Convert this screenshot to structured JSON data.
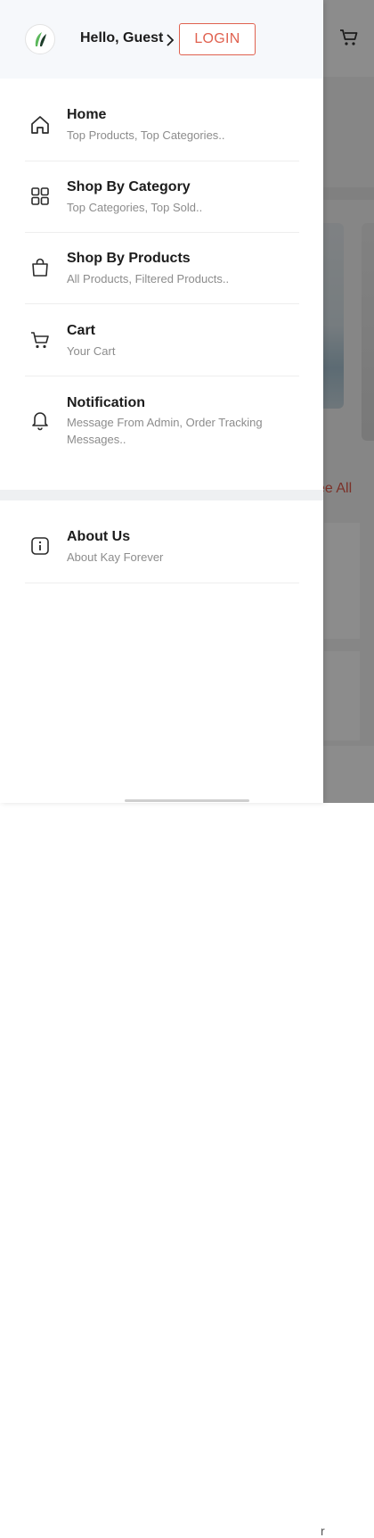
{
  "background": {
    "see_all_label": "ee All",
    "bottom_text": "r",
    "icons": [
      "cart-icon"
    ]
  },
  "drawer": {
    "greeting": "Hello, Guest",
    "login_label": "LOGIN",
    "colors": {
      "accent": "#e0614f",
      "logo_green": "#5cb85c",
      "logo_dark": "#1e3d2a"
    },
    "items": [
      {
        "title": "Home",
        "subtitle": "Top Products, Top Categories..",
        "icon": "home-icon"
      },
      {
        "title": "Shop By Category",
        "subtitle": "Top Categories, Top Sold..",
        "icon": "grid-icon"
      },
      {
        "title": "Shop By Products",
        "subtitle": "All Products, Filtered Products..",
        "icon": "bag-icon"
      },
      {
        "title": "Cart",
        "subtitle": "Your Cart",
        "icon": "cart-icon"
      },
      {
        "title": "Notification",
        "subtitle": "Message From Admin, Order Tracking Messages..",
        "icon": "bell-icon"
      }
    ],
    "about": {
      "title": "About Us",
      "subtitle": "About Kay Forever",
      "icon": "info-icon"
    }
  }
}
